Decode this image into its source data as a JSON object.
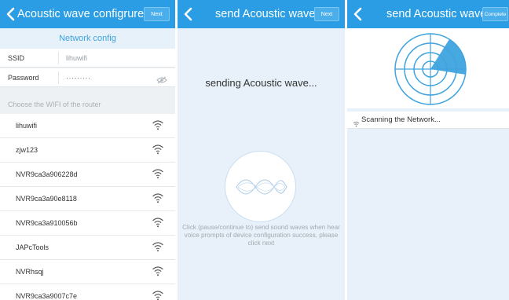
{
  "panel1": {
    "title": "Acoustic wave configrure",
    "next_label": "Next",
    "section_title": "Network config",
    "ssid": {
      "label": "SSID",
      "value": "lihuwifi"
    },
    "password": {
      "label": "Password",
      "value": "·········"
    },
    "choose_label": "Choose the WIFI of the router",
    "networks": [
      "lihuwifi",
      "zjw123",
      "NVR9ca3a906228d",
      "NVR9ca3a90e8118",
      "NVR9ca3a910056b",
      "JAPcTools",
      "NVRhsqj",
      "NVR9ca3a9007c7e"
    ]
  },
  "panel2": {
    "title": "send Acoustic wave",
    "next_label": "Next",
    "status": "sending Acoustic wave...",
    "hint": "Click (pause/continue to) send sound waves when hear voice prompts of device configuration success, please click next"
  },
  "panel3": {
    "title": "send Acoustic wave",
    "complete_label": "Complete",
    "scan_text": "Scanning the Network..."
  },
  "colors": {
    "header": "#2a9de4",
    "accent": "#3ea3de",
    "panel_bg": "#e8f1f9"
  }
}
